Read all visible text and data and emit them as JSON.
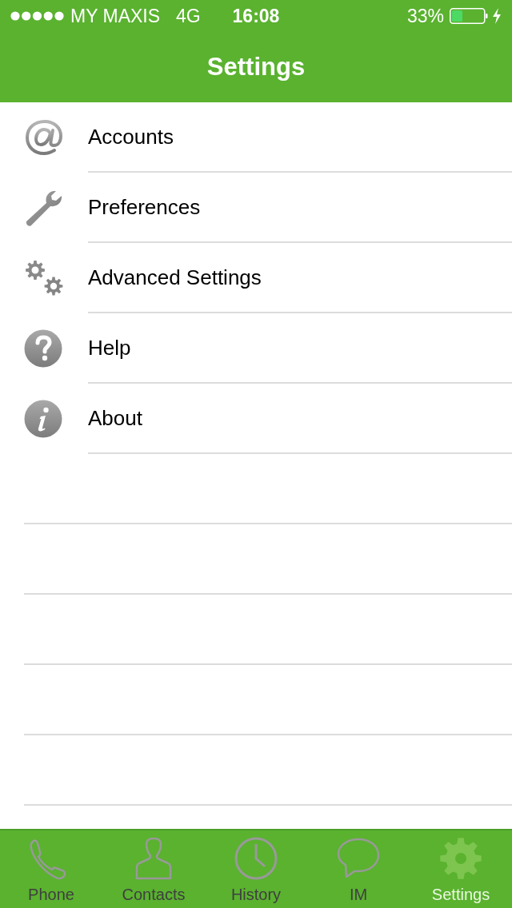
{
  "status_bar": {
    "carrier": "MY MAXIS",
    "network": "4G",
    "time": "16:08",
    "battery": "33%"
  },
  "nav_bar": {
    "title": "Settings"
  },
  "menu": [
    {
      "label": "Accounts"
    },
    {
      "label": "Preferences"
    },
    {
      "label": "Advanced Settings"
    },
    {
      "label": "Help"
    },
    {
      "label": "About"
    }
  ],
  "tab_bar": [
    {
      "label": "Phone",
      "selected": false
    },
    {
      "label": "Contacts",
      "selected": false
    },
    {
      "label": "History",
      "selected": false
    },
    {
      "label": "IM",
      "selected": false
    },
    {
      "label": "Settings",
      "selected": true
    }
  ]
}
